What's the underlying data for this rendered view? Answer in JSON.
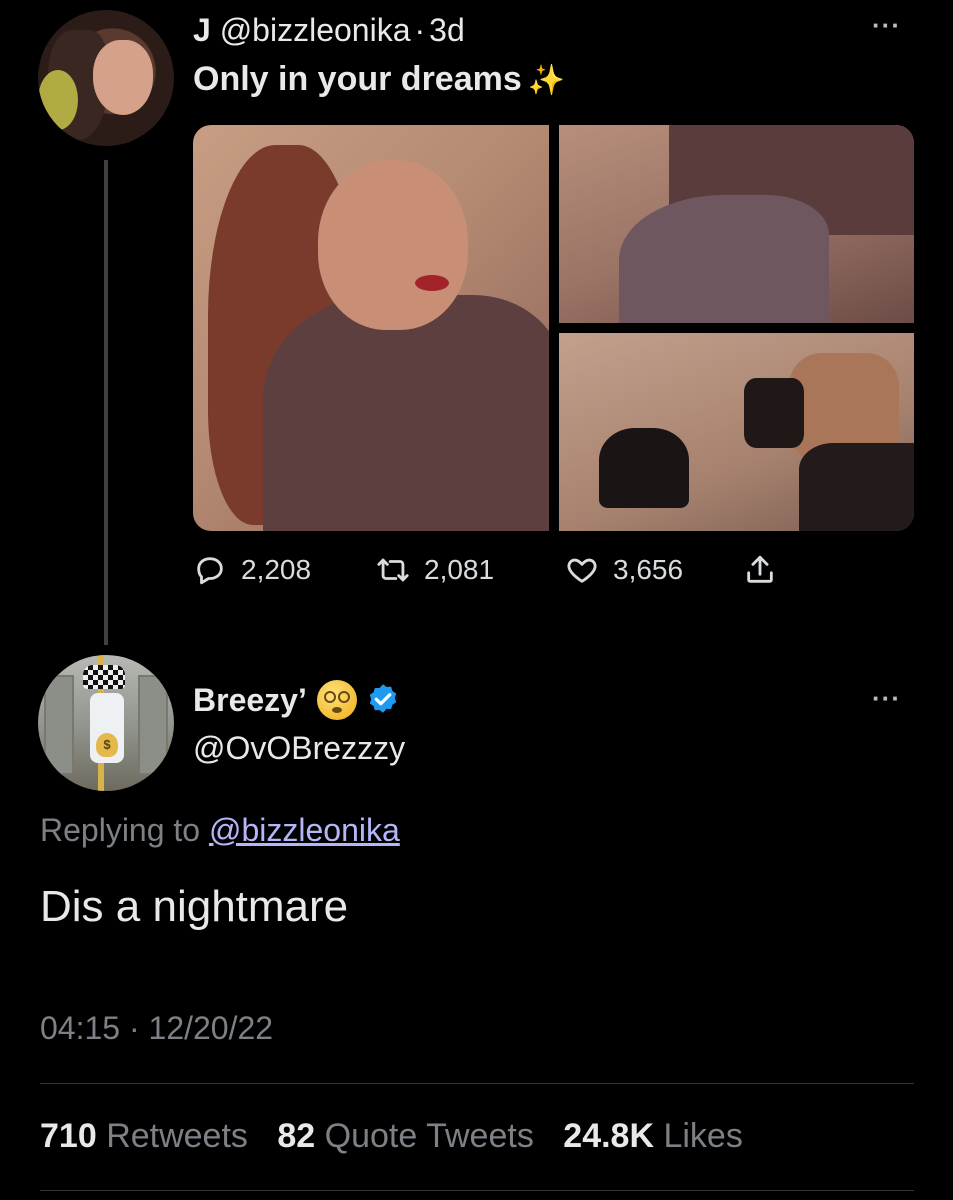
{
  "original_tweet": {
    "display_name": "J",
    "handle": "@bizzleonika",
    "separator": "·",
    "age": "3d",
    "text": "Only in your dreams",
    "emoji": "✨",
    "more_label": "···",
    "stats": {
      "replies": "2,208",
      "retweets": "2,081",
      "likes": "3,656"
    }
  },
  "reply_tweet": {
    "display_name": "Breezy’",
    "handle": "@OvOBrezzzy",
    "verified": true,
    "more_label": "···",
    "replying_prefix": "Replying to",
    "replying_to": "@bizzleonika",
    "text": "Dis a nightmare",
    "timestamp": "04:15 · 12/20/22",
    "counts": {
      "retweets_num": "710",
      "retweets_label": "Retweets",
      "quotes_num": "82",
      "quotes_label": "Quote Tweets",
      "likes_num": "24.8K",
      "likes_label": "Likes"
    }
  },
  "colors": {
    "background": "#000000",
    "text_primary": "#e7e9ea",
    "text_secondary": "#7d8186",
    "mention": "#b4b6f8",
    "verified_blue": "#1d9bf0"
  },
  "icons": [
    "reply-icon",
    "retweet-icon",
    "like-icon",
    "share-icon",
    "verified-badge-icon",
    "more-icon",
    "sparkles-icon",
    "dizzy-face-icon"
  ]
}
